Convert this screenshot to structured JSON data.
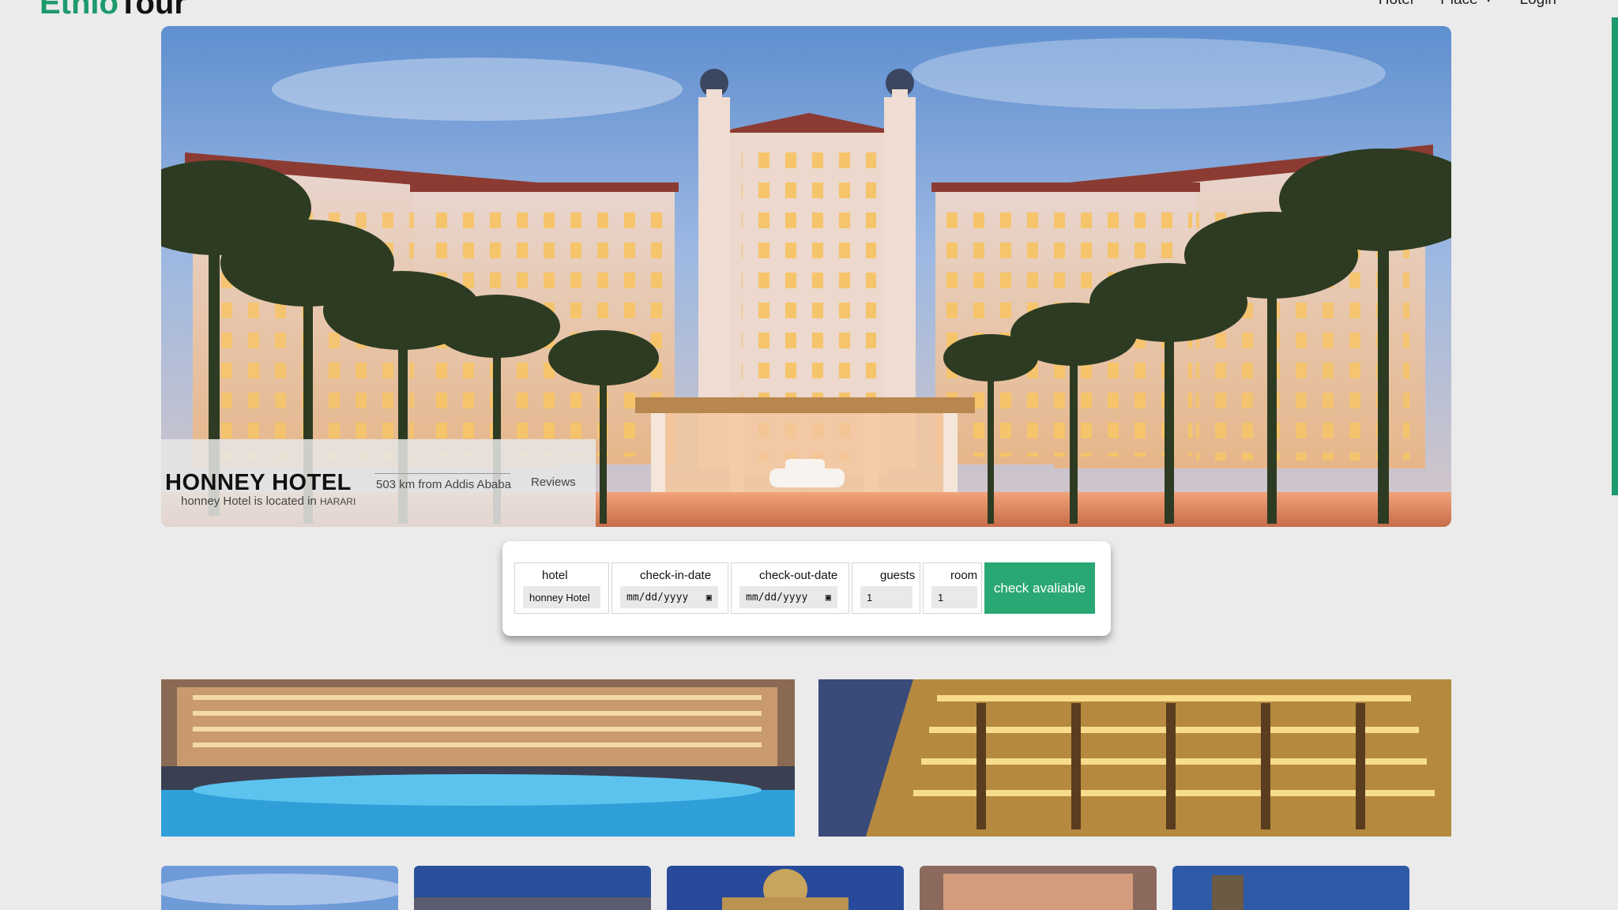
{
  "brand": {
    "part1": "Ethio",
    "part2": "Tour"
  },
  "nav": {
    "hotel": "Hotel",
    "place": "Place",
    "login": "Login"
  },
  "hero": {
    "title": "HONNEY HOTEL",
    "distance": "503 km from Addis Ababa",
    "reviews": "Reviews",
    "location_prefix": "honney Hotel is located in",
    "region": "HARARI"
  },
  "booking": {
    "hotel_label": "hotel",
    "hotel_value": "honney Hotel",
    "checkin_label": "check-in-date",
    "checkin_placeholder": "mm/dd/yyyy",
    "checkout_label": "check-out-date",
    "checkout_placeholder": "mm/dd/yyyy",
    "guests_label": "guests",
    "guests_value": "1",
    "room_label": "room",
    "room_value": "1",
    "submit_label": "check avaliable"
  },
  "colors": {
    "accent": "#2aa874",
    "brand_green": "#1d9a6c"
  },
  "icons": {
    "calendar": "calendar-icon",
    "dropdown": "chevron-down-icon"
  }
}
